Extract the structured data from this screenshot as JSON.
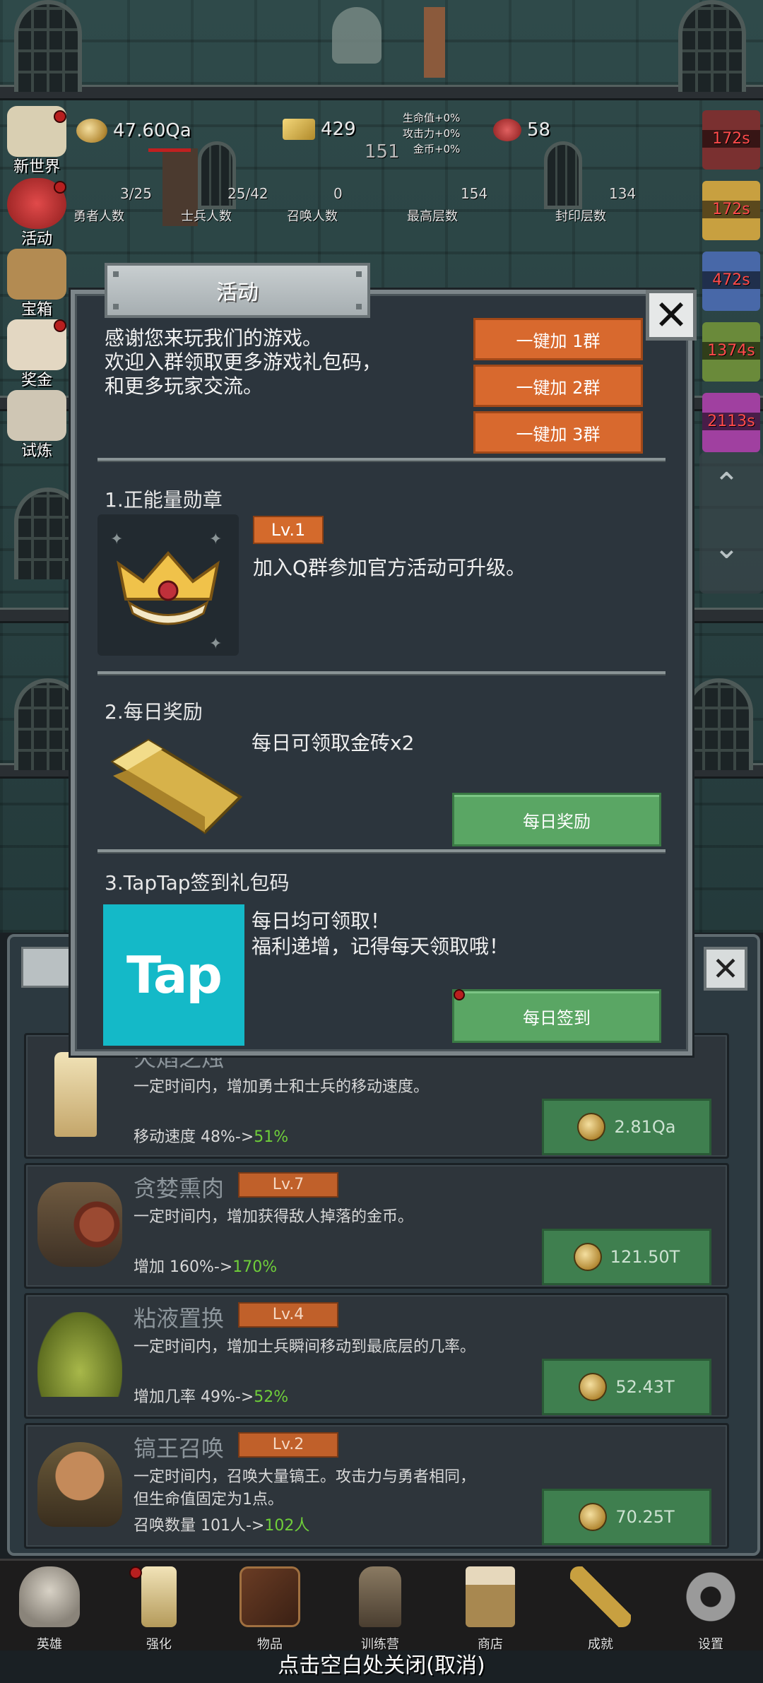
{
  "resources": {
    "gold": "47.60Qa",
    "gold_bricks": "429",
    "level_number": "151",
    "gems": "58",
    "buffs": [
      "生命值+0%",
      "攻击力+0%",
      "金币+0%"
    ]
  },
  "stats": [
    {
      "value": "3/25",
      "label": "勇者人数"
    },
    {
      "value": "25/42",
      "label": "士兵人数"
    },
    {
      "value": "0",
      "label": "召唤人数"
    },
    {
      "value": "154",
      "label": "最高层数"
    },
    {
      "value": "134",
      "label": "封印层数"
    }
  ],
  "side_menu": [
    {
      "label": "新世界"
    },
    {
      "label": "活动"
    },
    {
      "label": "宝箱"
    },
    {
      "label": "奖金"
    },
    {
      "label": "试炼"
    }
  ],
  "timers": [
    "172s",
    "172s",
    "472s",
    "1374s",
    "2113s"
  ],
  "modal": {
    "title": "活动",
    "intro_lines": [
      "感谢您来玩我们的游戏。",
      "欢迎入群领取更多游戏礼包码，",
      "和更多玩家交流。"
    ],
    "group_buttons": [
      "一键加 1群",
      "一键加 2群",
      "一键加 3群"
    ],
    "section1": {
      "title": "1.正能量勋章",
      "level": "Lv.1",
      "desc": "加入Q群参加官方活动可升级。"
    },
    "section2": {
      "title": "2.每日奖励",
      "desc": "每日可领取金砖x2",
      "button": "每日奖励"
    },
    "section3": {
      "title": "3.TapTap签到礼包码",
      "logo_text": "Tap",
      "desc_lines": [
        "每日均可领取！",
        "福利递增，记得每天领取哦！"
      ],
      "button": "每日签到"
    }
  },
  "skills": [
    {
      "name": "火焰之烛",
      "level": "",
      "desc": "一定时间内，增加勇士和士兵的移动速度。",
      "stat_prefix": "移动速度 48%->",
      "stat_new": "51%",
      "price": "2.81Qa"
    },
    {
      "name": "贪婪熏肉",
      "level": "Lv.7",
      "desc": "一定时间内，增加获得敌人掉落的金币。",
      "stat_prefix": "增加 160%->",
      "stat_new": "170%",
      "price": "121.50T"
    },
    {
      "name": "粘液置换",
      "level": "Lv.4",
      "desc": "一定时间内，增加士兵瞬间移动到最底层的几率。",
      "stat_prefix": "增加几率 49%->",
      "stat_new": "52%",
      "price": "52.43T"
    },
    {
      "name": "镐王召唤",
      "level": "Lv.2",
      "desc": "一定时间内，召唤大量镐王。攻击力与勇者相同，",
      "desc2": "但生命值固定为1点。",
      "stat_prefix": "召唤数量 101人->",
      "stat_new": "102人",
      "price": "70.25T"
    }
  ],
  "bottom_nav": [
    {
      "label": "英雄",
      "icon": "skull-icon"
    },
    {
      "label": "强化",
      "icon": "candle-icon"
    },
    {
      "label": "物品",
      "icon": "book-icon"
    },
    {
      "label": "训练营",
      "icon": "lantern-icon"
    },
    {
      "label": "商店",
      "icon": "mug-icon"
    },
    {
      "label": "成就",
      "icon": "key-icon"
    },
    {
      "label": "设置",
      "icon": "gear-icon"
    }
  ],
  "close_hint": "点击空白处关闭(取消)"
}
